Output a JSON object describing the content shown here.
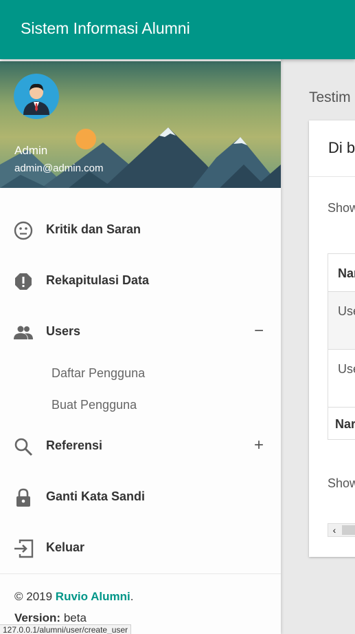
{
  "app": {
    "title": "Sistem Informasi Alumni"
  },
  "user": {
    "name": "Admin",
    "email": "admin@admin.com"
  },
  "menu": {
    "items": [
      {
        "label": "Kritik dan Saran",
        "icon": "smiley-face-icon"
      },
      {
        "label": "Rekapitulasi Data",
        "icon": "alert-octagon-icon"
      },
      {
        "label": "Users",
        "icon": "people-icon",
        "toggle": "−"
      },
      {
        "label": "Referensi",
        "icon": "search-icon",
        "toggle": "+"
      },
      {
        "label": "Ganti Kata Sandi",
        "icon": "lock-icon"
      },
      {
        "label": "Keluar",
        "icon": "logout-icon"
      }
    ],
    "submenu": [
      {
        "label": "Daftar Pengguna"
      },
      {
        "label": "Buat Pengguna"
      }
    ]
  },
  "footer": {
    "copyright_prefix": "© 2019 ",
    "brand": "Ruvio Alumni",
    "period": ".",
    "version_label": "Version:",
    "version_value": " beta"
  },
  "content": {
    "block_header": "Testim",
    "card_title": "Di b",
    "show_top": "Show",
    "table": {
      "header": "Nar",
      "rows": [
        "Use",
        "Use"
      ],
      "footer": "Nar"
    },
    "show_bottom": "Show"
  },
  "statusbar": {
    "url": "127.0.0.1/alumni/user/create_user"
  },
  "colors": {
    "accent": "#009688"
  }
}
